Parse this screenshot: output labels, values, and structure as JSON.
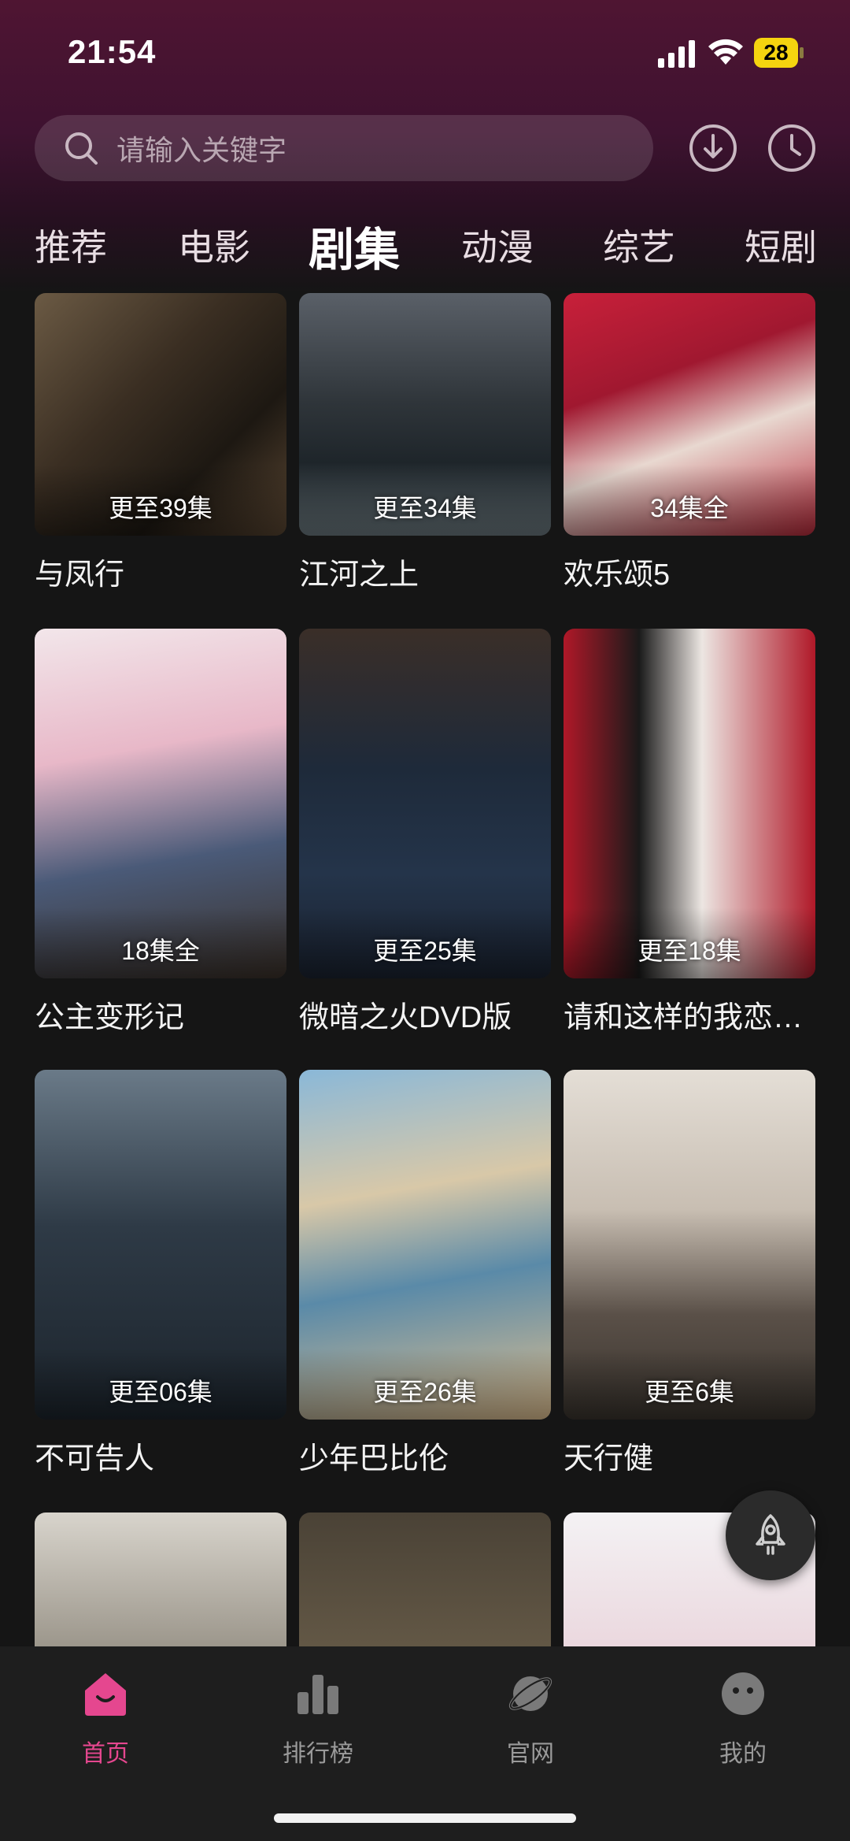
{
  "status_bar": {
    "time": "21:54",
    "battery": "28"
  },
  "search": {
    "placeholder": "请输入关键字"
  },
  "tabs": [
    {
      "label": "推荐"
    },
    {
      "label": "电影"
    },
    {
      "label": "剧集",
      "active": true
    },
    {
      "label": "动漫"
    },
    {
      "label": "综艺"
    },
    {
      "label": "短剧"
    }
  ],
  "shows": [
    {
      "title": "与凤行",
      "badge": "更至39集"
    },
    {
      "title": "江河之上",
      "badge": "更至34集"
    },
    {
      "title": "欢乐颂5",
      "badge": "34集全"
    },
    {
      "title": "公主变形记",
      "badge": "18集全"
    },
    {
      "title": "微暗之火DVD版",
      "badge": "更至25集"
    },
    {
      "title": "请和这样的我恋爱吧",
      "badge": "更至18集"
    },
    {
      "title": "不可告人",
      "badge": "更至06集"
    },
    {
      "title": "少年巴比伦",
      "badge": "更至26集"
    },
    {
      "title": "天行健",
      "badge": "更至6集"
    }
  ],
  "nav": [
    {
      "label": "首页",
      "icon": "home-icon",
      "active": true
    },
    {
      "label": "排行榜",
      "icon": "ranking-icon"
    },
    {
      "label": "官网",
      "icon": "planet-icon"
    },
    {
      "label": "我的",
      "icon": "profile-icon"
    }
  ],
  "colors": {
    "accent": "#e5478f",
    "header": "#4f1532",
    "background": "#151515"
  }
}
